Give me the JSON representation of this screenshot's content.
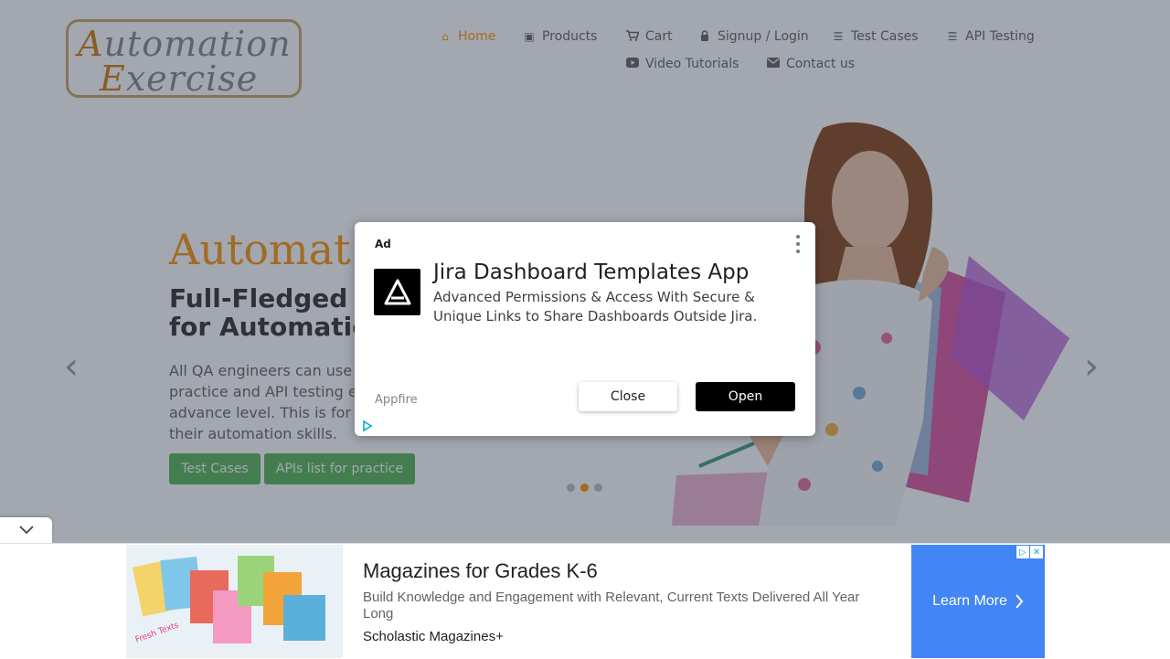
{
  "logo": {
    "line1_cap": "A",
    "line1_rest": "utomation",
    "line2_cap": "E",
    "line2_rest": "xercise"
  },
  "nav": {
    "home": "Home",
    "products": "Products",
    "cart": "Cart",
    "signup_login": "Signup / Login",
    "test_cases": "Test Cases",
    "api_testing": "API Testing",
    "video_tutorials": "Video Tutorials",
    "contact_us": "Contact us"
  },
  "hero": {
    "title": "Automat",
    "subtitle_line1": "Full-Fledged",
    "subtitle_line2": "for Automatio",
    "text_lines": [
      "All QA engineers can use",
      "practice and API testing e",
      "advance level. This is for",
      "their automation skills."
    ],
    "btn_test_cases": "Test Cases",
    "btn_apis": "APIs list for practice",
    "active_slide": 2,
    "slide_count": 3
  },
  "modal_ad": {
    "label": "Ad",
    "title": "Jira Dashboard Templates App",
    "description": "Advanced Permissions & Access With Secure & Unique Links to Share Dashboards Outside Jira.",
    "advertiser": "Appfire",
    "close_label": "Close",
    "open_label": "Open"
  },
  "bottom_ad": {
    "title": "Magazines for Grades K-6",
    "description": "Build Knowledge and Engagement with Relevant, Current Texts Delivered All Year Long",
    "advertiser": "Scholastic Magazines+",
    "cta": "Learn More"
  },
  "colors": {
    "accent": "#fe980f",
    "green": "#5cb85c",
    "cta_blue": "#4285f4"
  }
}
